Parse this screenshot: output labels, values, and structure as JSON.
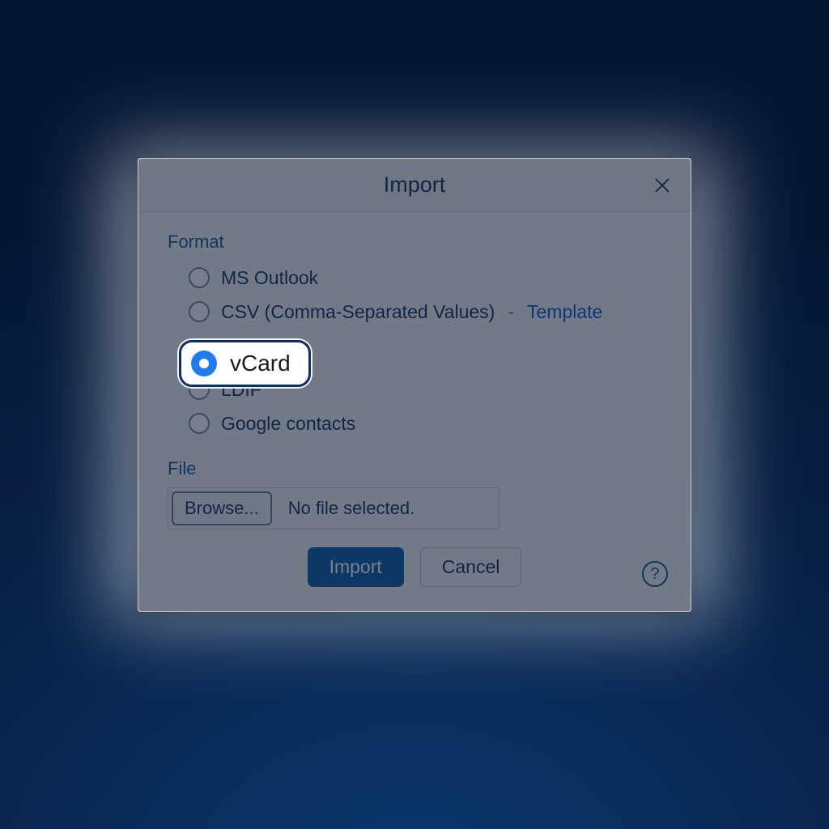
{
  "dialog": {
    "title": "Import",
    "formatLabel": "Format",
    "options": {
      "outlook": "MS Outlook",
      "csv": "CSV (Comma-Separated Values)",
      "csvTemplate": "Template",
      "vcard": "vCard",
      "ldif": "LDIF",
      "google": "Google contacts"
    },
    "fileLabel": "File",
    "browse": "Browse...",
    "noFile": "No file selected.",
    "importBtn": "Import",
    "cancelBtn": "Cancel",
    "help": "?"
  }
}
